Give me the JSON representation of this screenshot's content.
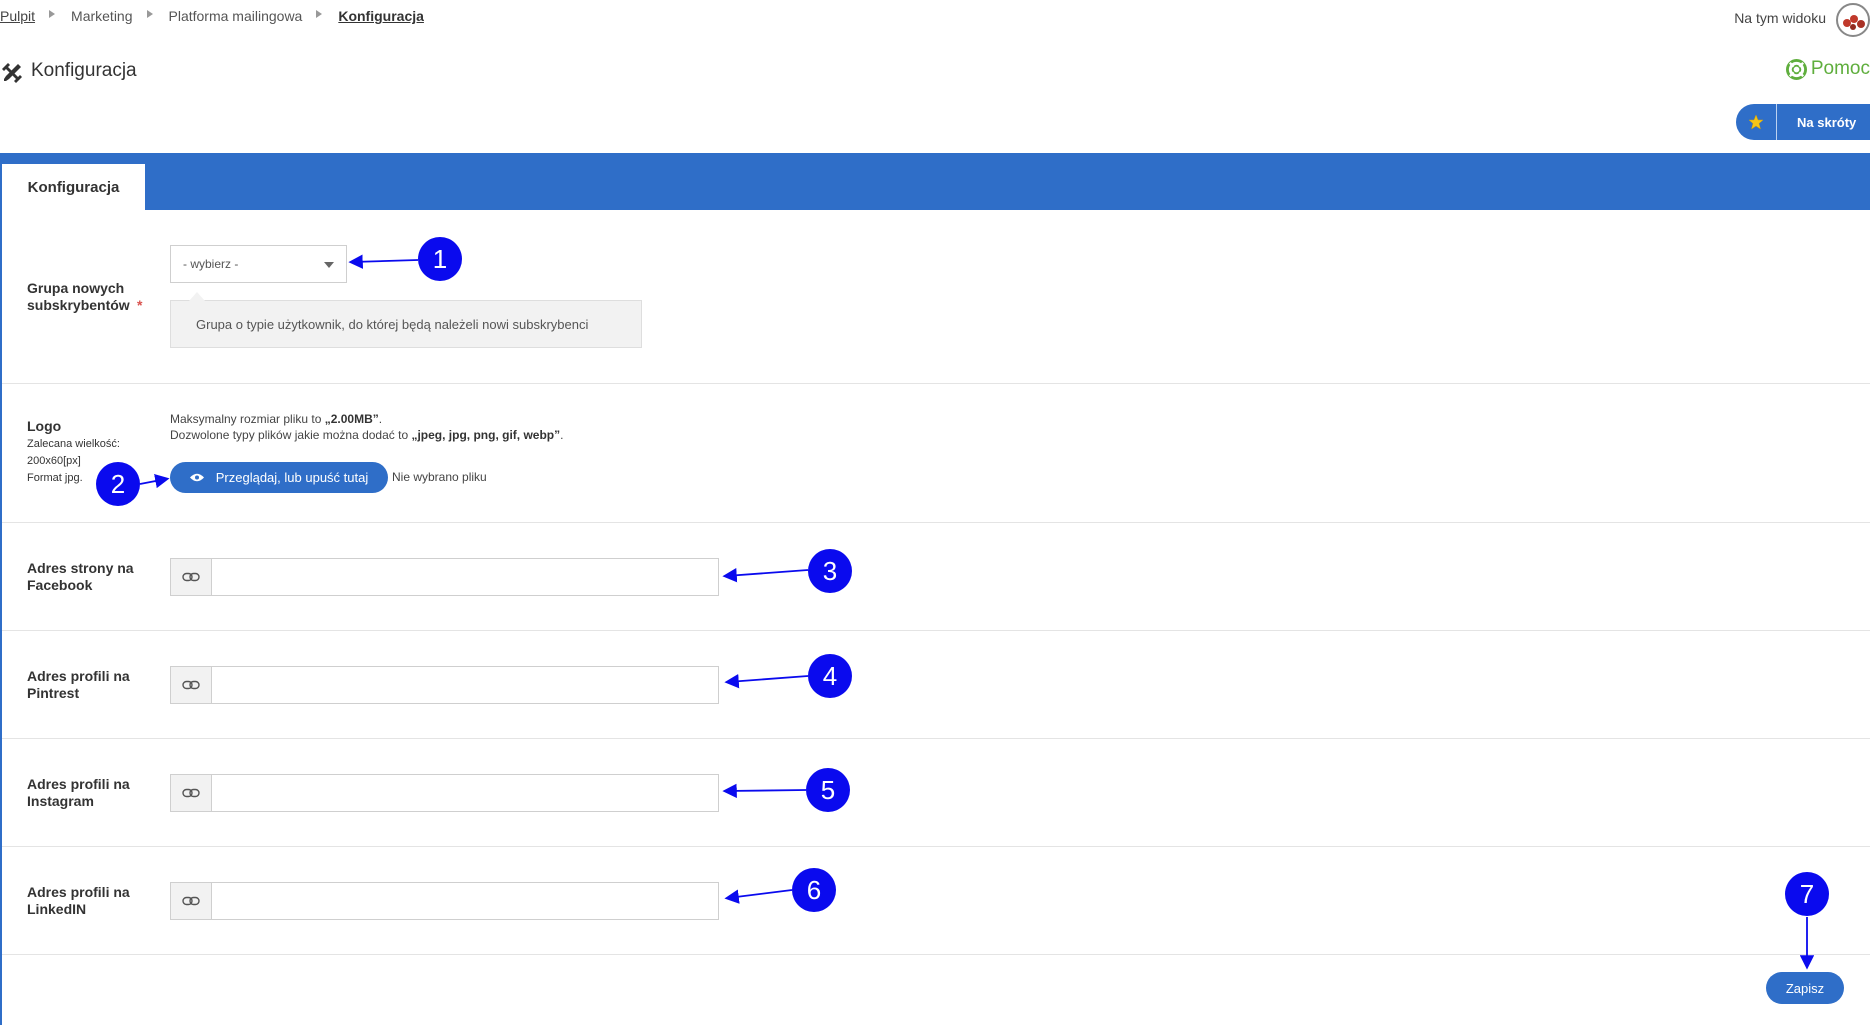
{
  "breadcrumb": {
    "items": [
      "Pulpit",
      "Marketing",
      "Platforma mailingowa",
      "Konfiguracja"
    ]
  },
  "header": {
    "view_label": "Na tym widoku",
    "page_title": "Konfiguracja",
    "help_label": "Pomoc",
    "shortcuts_label": "Na skróty"
  },
  "tabs": [
    {
      "label": "Konfiguracja",
      "active": true
    }
  ],
  "form": {
    "group": {
      "label": "Grupa nowych subskrybentów",
      "required_mark": "*",
      "select_value": "- wybierz -",
      "hint": "Grupa o typie użytkownik, do której będą należeli nowi subskrybenci"
    },
    "logo": {
      "label": "Logo",
      "sub1": "Zalecana wielkość:",
      "sub2": "200x60[px]",
      "sub3": "Format jpg.",
      "max_size_prefix": "Maksymalny rozmiar pliku to ",
      "max_size_value": "„2.00MB”",
      "max_size_suffix": ".",
      "types_prefix": "Dozwolone typy plików jakie można dodać to ",
      "types_value": "„jpeg, jpg, png, gif, webp”",
      "types_suffix": ".",
      "browse_label": "Przeglądaj, lub upuść tutaj",
      "no_file": "Nie wybrano pliku"
    },
    "facebook": {
      "label_line1": "Adres strony na",
      "label_line2": "Facebook",
      "value": ""
    },
    "pinterest": {
      "label_line1": "Adres profili na",
      "label_line2": "Pintrest",
      "value": ""
    },
    "instagram": {
      "label_line1": "Adres profili na",
      "label_line2": "Instagram",
      "value": ""
    },
    "linkedin": {
      "label_line1": "Adres profili na",
      "label_line2": "LinkedIN",
      "value": ""
    },
    "save_label": "Zapisz"
  },
  "annotations": [
    "1",
    "2",
    "3",
    "4",
    "5",
    "6",
    "7"
  ],
  "colors": {
    "primary": "#2f6ec8",
    "help": "#5fae3d",
    "badge": "#0a0aee",
    "required": "#d9534f"
  }
}
